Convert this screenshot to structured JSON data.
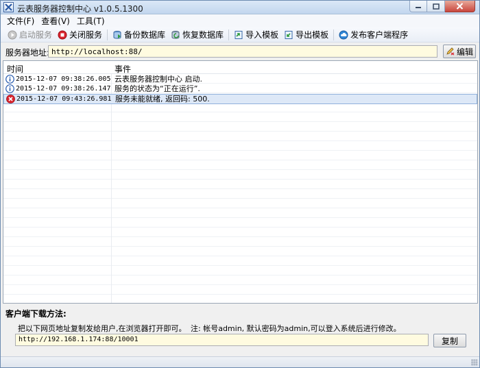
{
  "window": {
    "title": "云表服务器控制中心 v1.0.5.1300"
  },
  "menu": [
    {
      "label": "文件(F)"
    },
    {
      "label": "查看(V)"
    },
    {
      "label": "工具(T)"
    }
  ],
  "toolbar": {
    "start_label": "启动服务",
    "stop_label": "关闭服务",
    "backup_label": "备份数据库",
    "restore_label": "恢复数据库",
    "import_label": "导入模板",
    "export_label": "导出模板",
    "publish_label": "发布客户端程序"
  },
  "server": {
    "label": "服务器地址:",
    "url": "http://localhost:88/",
    "edit_label": "编辑"
  },
  "log": {
    "columns": {
      "time": "时间",
      "event": "事件"
    },
    "rows": [
      {
        "level": "info",
        "time": "2015-12-07 09:38:26.005",
        "event": "云表服务器控制中心 启动."
      },
      {
        "level": "info",
        "time": "2015-12-07 09:38:26.147",
        "event": "服务的状态为“正在运行”."
      },
      {
        "level": "error",
        "time": "2015-12-07 09:43:26.981",
        "event": "服务未能就绪, 返回码: 500."
      }
    ]
  },
  "download": {
    "title": "客户端下载方法:",
    "description": "把以下网页地址复制发给用户,在浏览器打开即可。",
    "note": "注: 帐号admin, 默认密码为admin,可以登入系统后进行修改。",
    "url": "http://192.168.1.174:88/10001",
    "copy_label": "复制"
  },
  "colors": {
    "input_bg": "#fffbe0",
    "selected_row": "#dde8f7",
    "info_icon": "#2a5db0",
    "error_icon": "#d9232d",
    "stop_icon": "#d9232d"
  },
  "icons": {
    "start": "play-circle-icon",
    "stop": "stop-circle-icon",
    "backup": "database-backup-icon",
    "restore": "database-restore-icon",
    "import": "import-template-icon",
    "export": "export-template-icon",
    "publish": "cloud-upload-icon",
    "edit": "pencil-icon",
    "info": "info-icon",
    "error": "error-x-icon"
  }
}
